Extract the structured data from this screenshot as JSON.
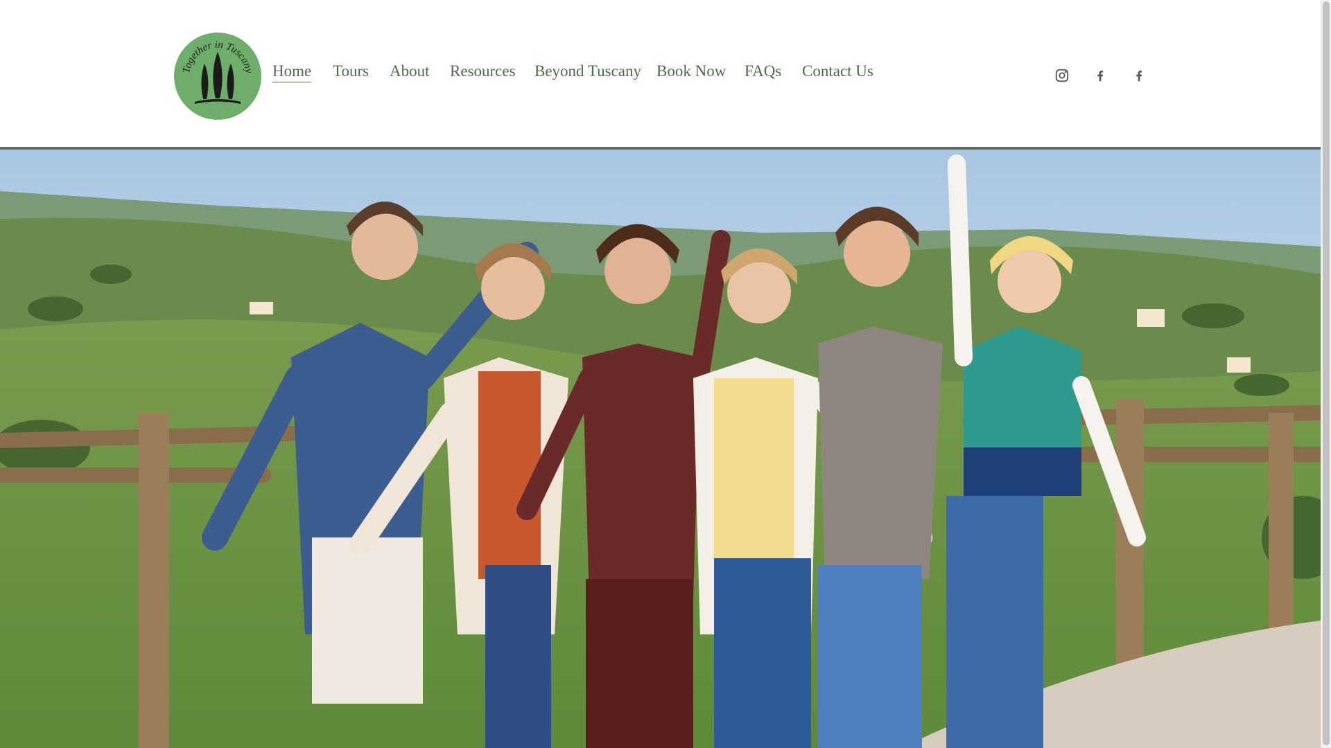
{
  "brand": {
    "logo_text": "Together in Tuscany",
    "logo_color": "#6fae6a"
  },
  "nav": {
    "items": [
      {
        "label": "Home",
        "active": true
      },
      {
        "label": "Tours"
      },
      {
        "label": "About"
      },
      {
        "label": "Resources"
      },
      {
        "label": "Beyond Tuscany"
      },
      {
        "label": "Book Now"
      },
      {
        "label": "FAQs"
      },
      {
        "label": "Contact Us"
      }
    ]
  },
  "social": [
    {
      "icon": "instagram-icon"
    },
    {
      "icon": "facebook-icon"
    },
    {
      "icon": "facebook-icon"
    }
  ],
  "colors": {
    "nav_text": "#4e6a48",
    "header_rule": "#5d6c5a",
    "icon": "#555555"
  },
  "hero": {
    "image": "group-of-six-women-posing-at-wooden-fence-tuscan-hills"
  }
}
